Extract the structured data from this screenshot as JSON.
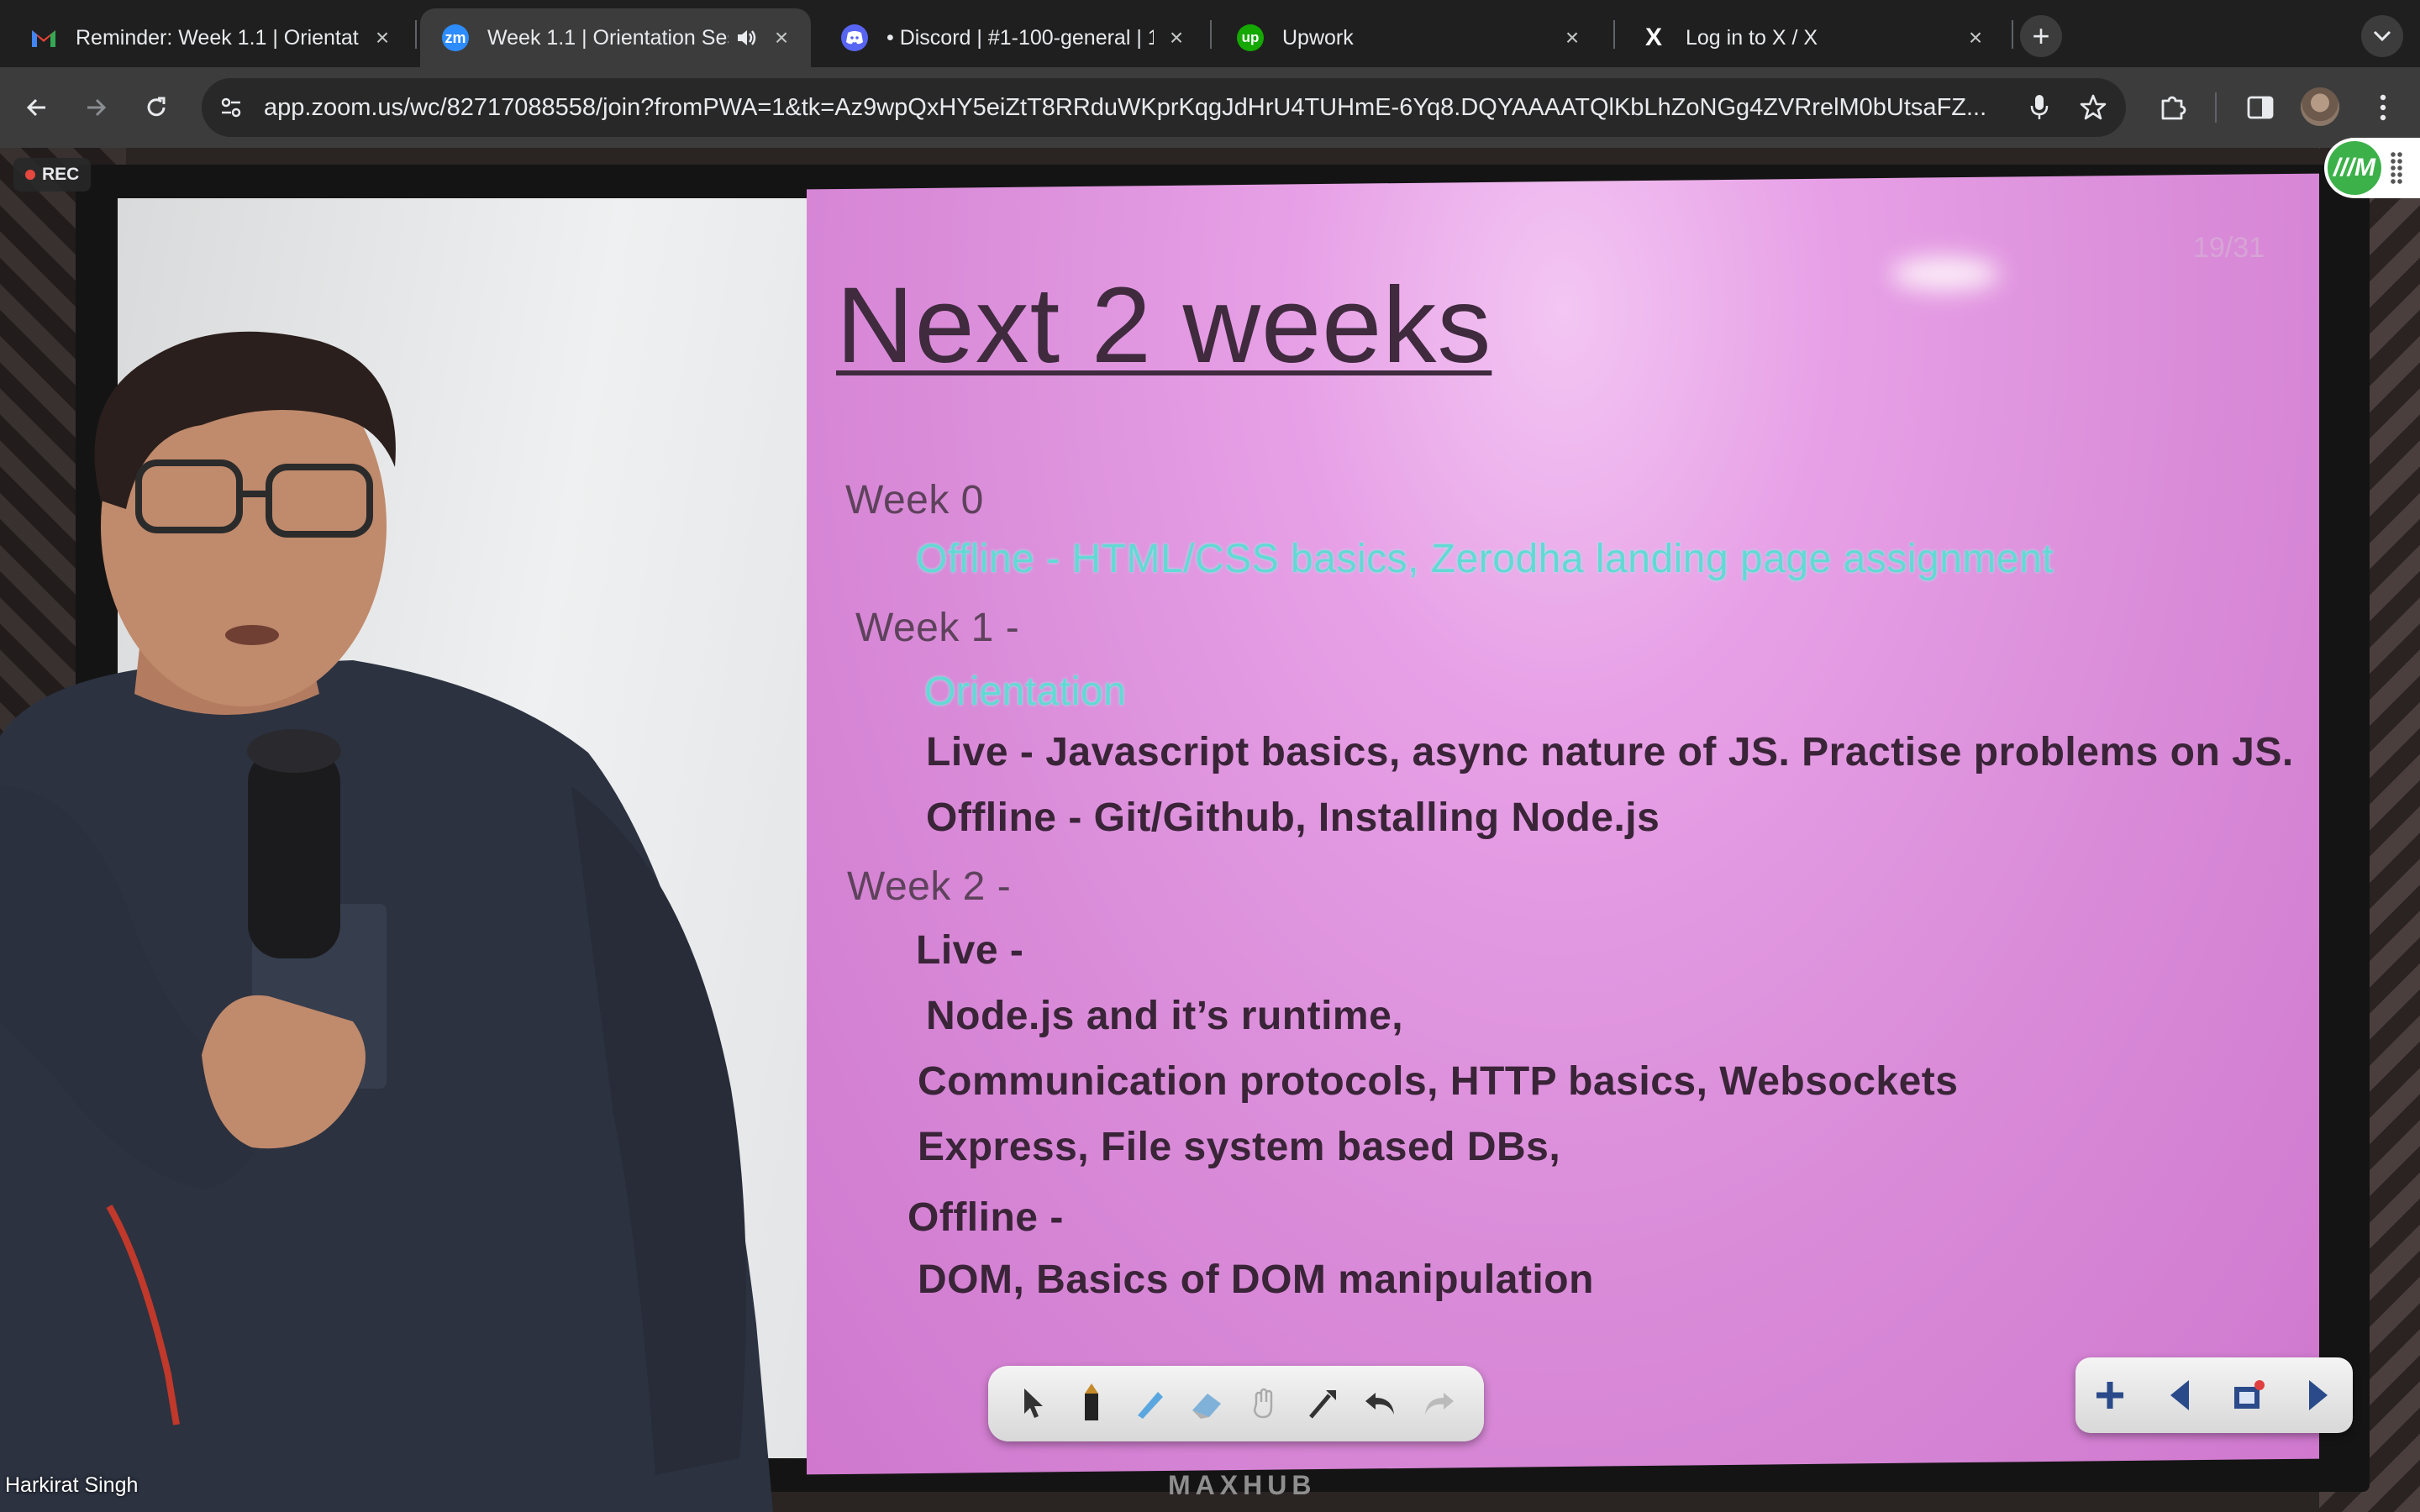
{
  "tabs": [
    {
      "title": "Reminder: Week 1.1 | Orientat",
      "favicon": "gmail-icon",
      "color": "#ea4335",
      "active": false
    },
    {
      "title": "Week 1.1 | Orientation Ses",
      "favicon": "zoom-icon",
      "color": "#2d8cff",
      "active": true,
      "favicon_text": "zm"
    },
    {
      "title": "• Discord | #1-100-general | 1",
      "favicon": "discord-icon",
      "color": "#5865f2",
      "active": false
    },
    {
      "title": "Upwork",
      "favicon": "upwork-icon",
      "color": "#14a800",
      "active": false,
      "favicon_text": "up"
    },
    {
      "title": "Log in to X / X",
      "favicon": "x-icon",
      "color": "#000000",
      "active": false,
      "favicon_text": "X"
    }
  ],
  "address_bar": {
    "url": "app.zoom.us/wc/82717088558/join?fromPWA=1&tk=Az9wpQxHY5eiZtT8RRduWKprKqgJdHrU4TUHmE-6Yq8.DQYAAAATQlKbLhZoNGg4ZVRrelM0bUtsaFZ..."
  },
  "zoom": {
    "rec_label": "REC",
    "speaker_name": "Harkirat Singh",
    "extension_label": "///M"
  },
  "slide": {
    "page_number": "19/31",
    "title": "Next 2 weeks",
    "lines": [
      {
        "text": "Week 0",
        "style": "heading"
      },
      {
        "text": "Offline - HTML/CSS basics, Zerodha landing page assignment",
        "style": "teal"
      },
      {
        "text": "Week 1 -",
        "style": "heading"
      },
      {
        "text": "Orientation",
        "style": "teal"
      },
      {
        "text": "Live - Javascript basics, async nature of JS. Practise problems on JS.",
        "style": "body"
      },
      {
        "text": "Offline - Git/Github, Installing Node.js",
        "style": "body"
      },
      {
        "text": "Week 2 -",
        "style": "heading"
      },
      {
        "text": "Live -",
        "style": "body"
      },
      {
        "text": "Node.js and it’s runtime,",
        "style": "body"
      },
      {
        "text": "Communication protocols, HTTP basics, Websockets",
        "style": "body"
      },
      {
        "text": "Express, File system based DBs,",
        "style": "body"
      },
      {
        "text": "Offline -",
        "style": "body"
      },
      {
        "text": "DOM, Basics of DOM manipulation",
        "style": "body"
      }
    ]
  },
  "whiteboard": {
    "brand": "MAXHUB"
  }
}
